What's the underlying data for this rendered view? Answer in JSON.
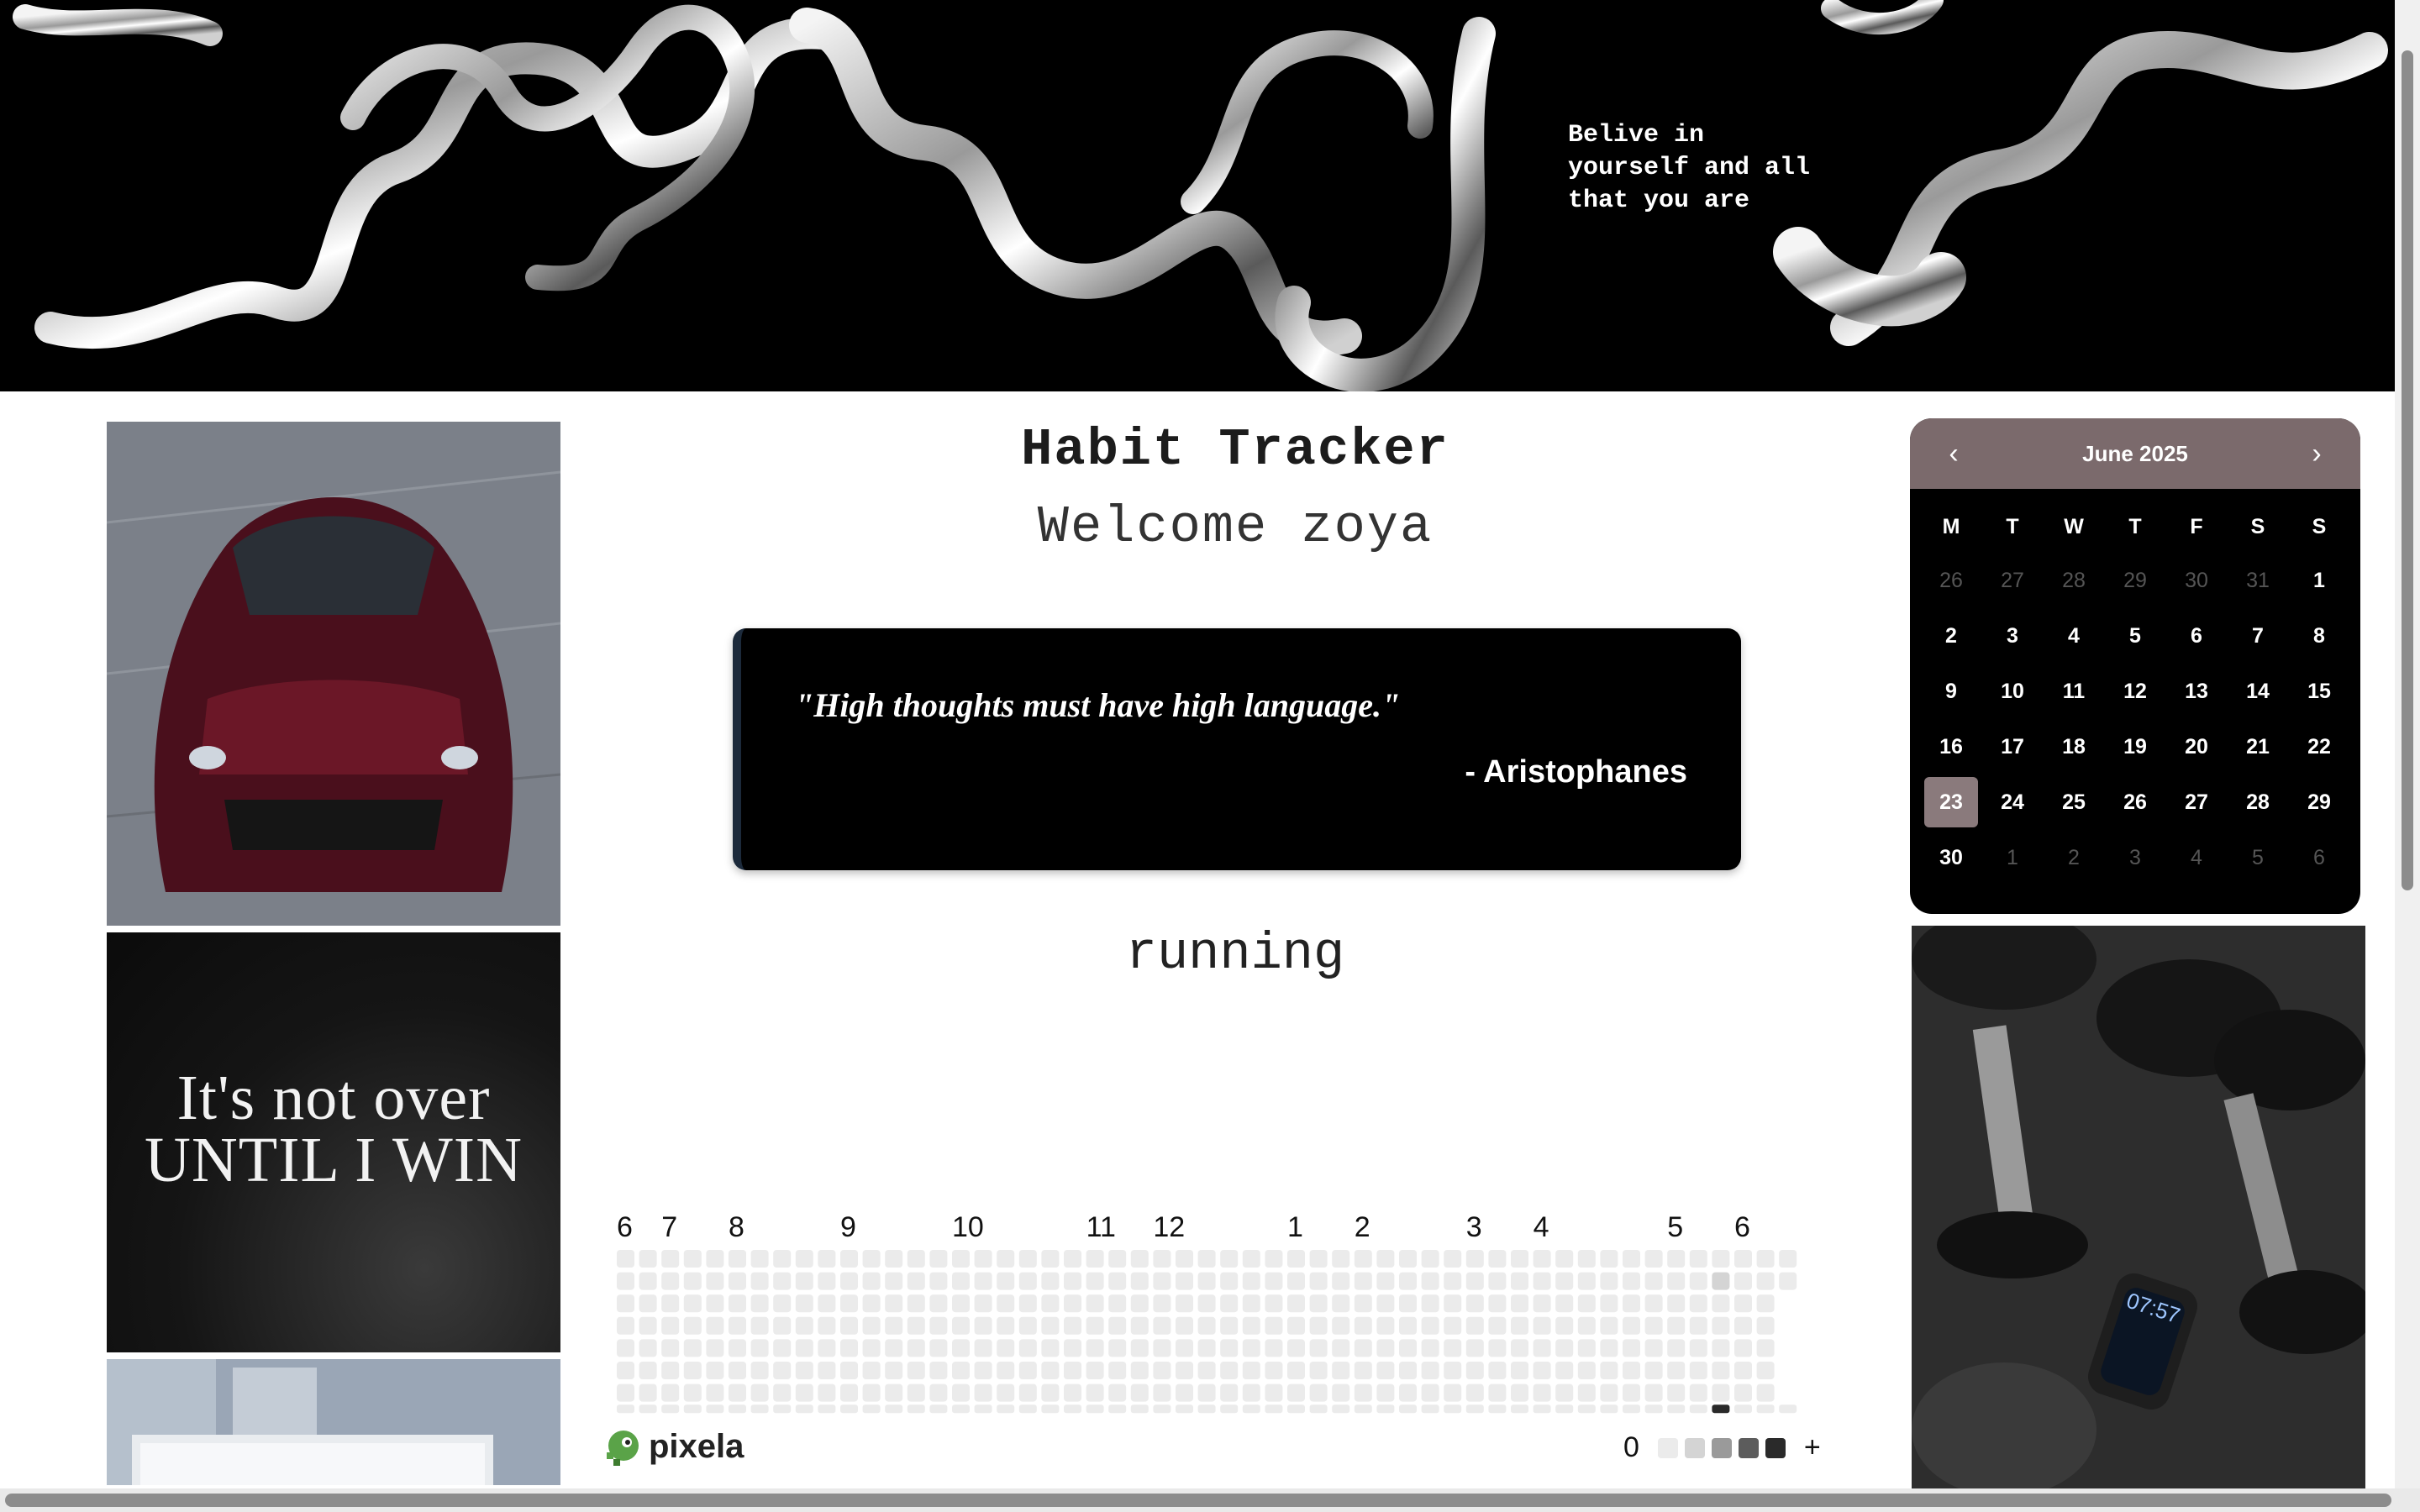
{
  "banner": {
    "quote": "Belive in\nyourself and all\nthat you are"
  },
  "left_images": [
    {
      "name": "sports-car-photo"
    },
    {
      "name": "motivation-poster",
      "text_line1": "It's not over",
      "text_line2": "UNTIL I WIN"
    },
    {
      "name": "office-laptop-photo"
    }
  ],
  "main": {
    "title": "Habit Tracker",
    "welcome": "Welcome zoya",
    "quote": {
      "text": "\"High thoughts must have high language.\"",
      "author": "- Aristophanes"
    },
    "habit_name": "running"
  },
  "graph": {
    "month_labels": [
      "6",
      "7",
      "8",
      "9",
      "10",
      "11",
      "12",
      "1",
      "2",
      "3",
      "4",
      "5",
      "6"
    ],
    "brand": "pixela",
    "legend": {
      "low": "0",
      "high": "+"
    },
    "colors": {
      "empty": "#ebebeb",
      "light": "#d4d4d4",
      "level2": "#9a9a9a",
      "level3": "#5c5c5c",
      "dark": "#2a2a2a"
    }
  },
  "calendar": {
    "month_label": "June 2025",
    "prev": "‹",
    "next": "›",
    "weekdays": [
      "M",
      "T",
      "W",
      "T",
      "F",
      "S",
      "S"
    ],
    "days": [
      {
        "d": "26",
        "out": true
      },
      {
        "d": "27",
        "out": true
      },
      {
        "d": "28",
        "out": true
      },
      {
        "d": "29",
        "out": true
      },
      {
        "d": "30",
        "out": true
      },
      {
        "d": "31",
        "out": true
      },
      {
        "d": "1"
      },
      {
        "d": "2"
      },
      {
        "d": "3"
      },
      {
        "d": "4"
      },
      {
        "d": "5"
      },
      {
        "d": "6"
      },
      {
        "d": "7"
      },
      {
        "d": "8"
      },
      {
        "d": "9"
      },
      {
        "d": "10"
      },
      {
        "d": "11"
      },
      {
        "d": "12"
      },
      {
        "d": "13"
      },
      {
        "d": "14"
      },
      {
        "d": "15"
      },
      {
        "d": "16"
      },
      {
        "d": "17"
      },
      {
        "d": "18"
      },
      {
        "d": "19"
      },
      {
        "d": "20"
      },
      {
        "d": "21"
      },
      {
        "d": "22"
      },
      {
        "d": "23",
        "selected": true
      },
      {
        "d": "24"
      },
      {
        "d": "25"
      },
      {
        "d": "26"
      },
      {
        "d": "27"
      },
      {
        "d": "28"
      },
      {
        "d": "29"
      },
      {
        "d": "30"
      },
      {
        "d": "1",
        "out": true
      },
      {
        "d": "2",
        "out": true
      },
      {
        "d": "3",
        "out": true
      },
      {
        "d": "4",
        "out": true
      },
      {
        "d": "5",
        "out": true
      },
      {
        "d": "6",
        "out": true
      }
    ],
    "colors": {
      "header": "#7b6a6c",
      "selected": "#8a7a7c"
    }
  },
  "right_images": [
    {
      "name": "dumbbells-photo",
      "watch_time": "07:57"
    }
  ]
}
